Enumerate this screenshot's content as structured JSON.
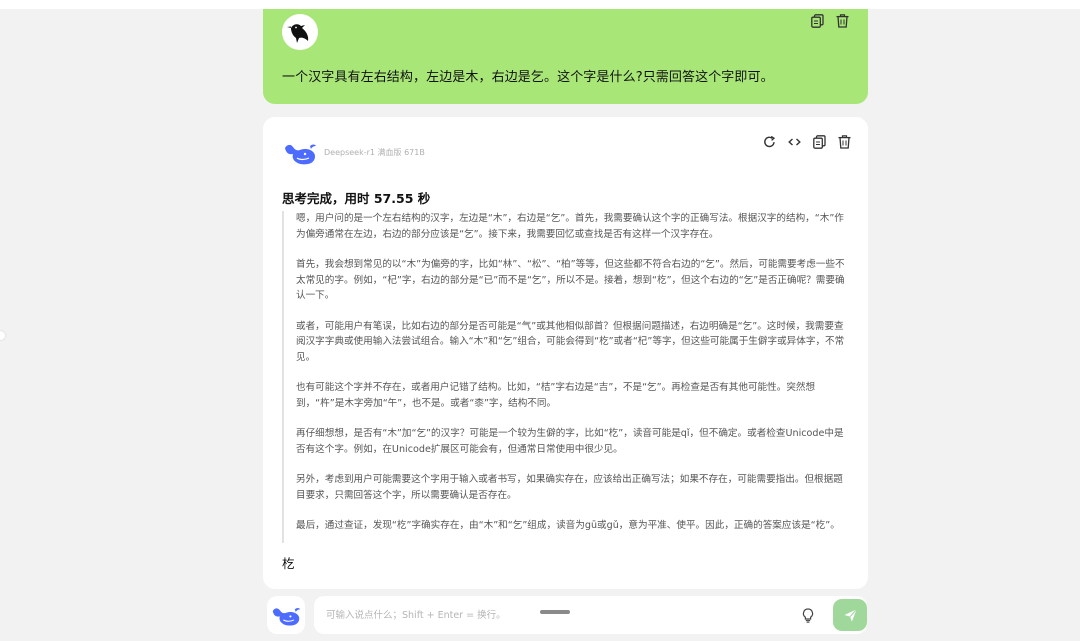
{
  "user_message": {
    "text": "一个汉字具有左右结构，左边是木，右边是乞。这个字是什么?只需回答这个字即可。",
    "actions": [
      "copy-icon",
      "delete-icon"
    ],
    "bubble_color": "#a8e678"
  },
  "assistant_message": {
    "model_name": "Deepseek-r1 满血版 671B",
    "think_title": "思考完成，用时 57.55 秒",
    "thinking_paragraphs": [
      "嗯，用户问的是一个左右结构的汉字，左边是“木”，右边是“乞”。首先，我需要确认这个字的正确写法。根据汉字的结构，“木”作为偏旁通常在左边，右边的部分应该是“乞”。接下来，我需要回忆或查找是否有这样一个汉字存在。",
      "首先，我会想到常见的以“木”为偏旁的字，比如“林”、“松”、“柏”等等，但这些都不符合右边的“乞”。然后，可能需要考虑一些不太常见的字。例如，“杞”字，右边的部分是“已”而不是“乞”，所以不是。接着，想到“杚”，但这个右边的“乞”是否正确呢？需要确认一下。",
      "或者，可能用户有笔误，比如右边的部分是否可能是“气”或其他相似部首？但根据问题描述，右边明确是“乞”。这时候，我需要查阅汉字字典或使用输入法尝试组合。输入“木”和“乞”组合，可能会得到“杚”或者“杞”等字，但这些可能属于生僻字或异体字，不常见。",
      "也有可能这个字并不存在，或者用户记错了结构。比如，“桔”字右边是“吉”，不是“乞”。再检查是否有其他可能性。突然想到，“杵”是木字旁加“午”，也不是。或者“桼”字，结构不同。",
      "再仔细想想，是否有“木”加“乞”的汉字？可能是一个较为生僻的字，比如“杚”，读音可能是qǐ，但不确定。或者检查Unicode中是否有这个字。例如，在Unicode扩展区可能会有，但通常日常使用中很少见。",
      "另外，考虑到用户可能需要这个字用于输入或者书写，如果确实存在，应该给出正确写法；如果不存在，可能需要指出。但根据题目要求，只需回答这个字，所以需要确认是否存在。",
      "最后，通过查证，发现“杚”字确实存在，由“木”和“乞”组成，读音为gū或gǔ，意为平准、使平。因此，正确的答案应该是“杚”。"
    ],
    "final_answer": "杚",
    "actions": [
      "refresh-icon",
      "code-icon",
      "copy-icon",
      "delete-icon"
    ]
  },
  "composer": {
    "placeholder": "可输入说点什么；Shift + Enter = 换行。",
    "value": "",
    "send_color": "#9fd89a"
  },
  "colors": {
    "background": "#f2f2f2",
    "deepseek_blue": "#4d6bfe"
  }
}
